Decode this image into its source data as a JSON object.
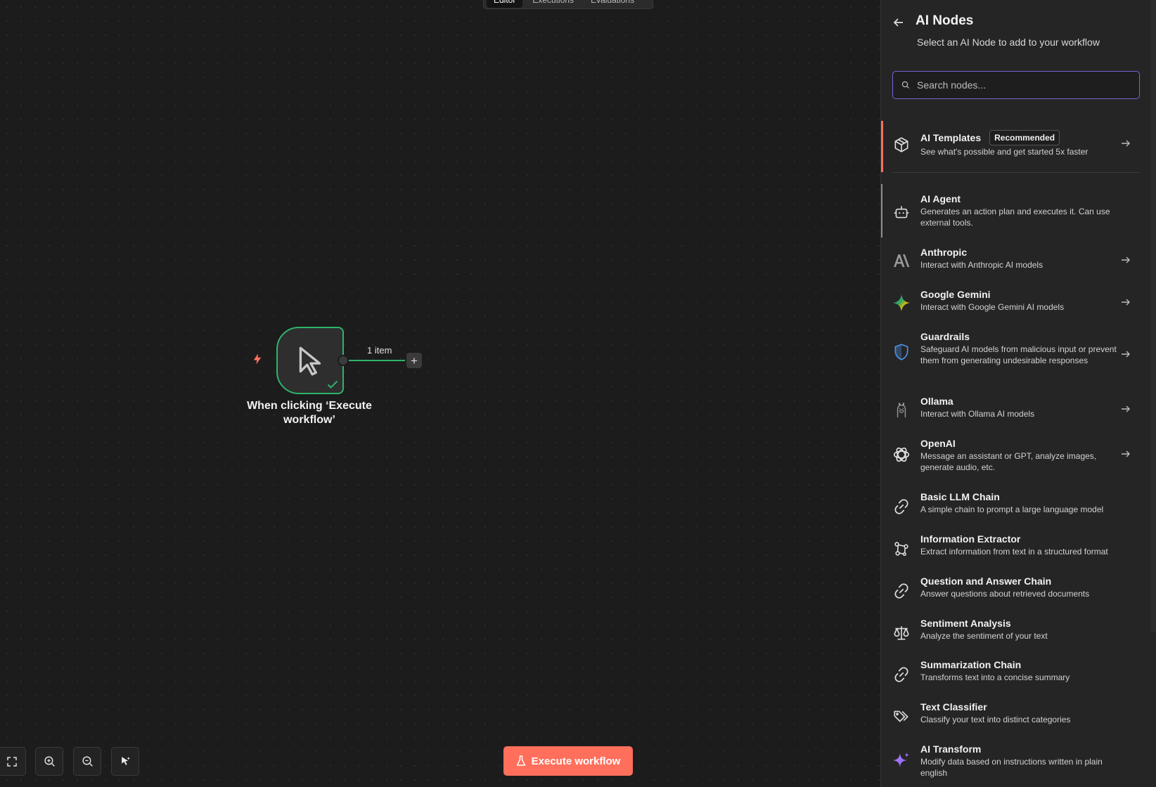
{
  "canvas": {
    "top_tabs": [
      "Editor",
      "Executions",
      "Evaluations"
    ],
    "node": {
      "label": "When clicking ‘Execute workflow’",
      "status": "success"
    },
    "connector_label": "1 item",
    "add_button": "+",
    "execute_button": "Execute workflow"
  },
  "panel": {
    "title": "AI Nodes",
    "subtitle": "Select an AI Node to add to your workflow",
    "search_placeholder": "Search nodes...",
    "templates": {
      "name": "AI Templates",
      "badge": "Recommended",
      "desc": "See what's possible and get started 5x faster"
    },
    "items": [
      {
        "name": "AI Agent",
        "desc": "Generates an action plan and executes it. Can use external tools.",
        "icon": "robot-icon",
        "arrow": false
      },
      {
        "name": "Anthropic",
        "desc": "Interact with Anthropic AI models",
        "icon": "anthropic-icon",
        "arrow": true
      },
      {
        "name": "Google Gemini",
        "desc": "Interact with Google Gemini AI models",
        "icon": "gemini-icon",
        "arrow": true
      },
      {
        "name": "Guardrails",
        "desc": "Safeguard AI models from malicious input or prevent them from generating undesirable responses",
        "icon": "shield-icon",
        "arrow": true
      },
      {
        "name": "Ollama",
        "desc": "Interact with Ollama AI models",
        "icon": "llama-icon",
        "arrow": true
      },
      {
        "name": "OpenAI",
        "desc": "Message an assistant or GPT, analyze images, generate audio, etc.",
        "icon": "openai-icon",
        "arrow": true
      },
      {
        "name": "Basic LLM Chain",
        "desc": "A simple chain to prompt a large language model",
        "icon": "link-icon",
        "arrow": false
      },
      {
        "name": "Information Extractor",
        "desc": "Extract information from text in a structured format",
        "icon": "nodes-icon",
        "arrow": false
      },
      {
        "name": "Question and Answer Chain",
        "desc": "Answer questions about retrieved documents",
        "icon": "link-icon",
        "arrow": false
      },
      {
        "name": "Sentiment Analysis",
        "desc": "Analyze the sentiment of your text",
        "icon": "scale-icon",
        "arrow": false
      },
      {
        "name": "Summarization Chain",
        "desc": "Transforms text into a concise summary",
        "icon": "link-icon",
        "arrow": false
      },
      {
        "name": "Text Classifier",
        "desc": "Classify your text into distinct categories",
        "icon": "tags-icon",
        "arrow": false
      },
      {
        "name": "AI Transform",
        "desc": "Modify data based on instructions written in plain english",
        "icon": "sparkles-icon",
        "arrow": false
      }
    ]
  },
  "colors": {
    "accent": "#ff6f5c",
    "success": "#2fb36a",
    "focus": "#7a63d6"
  }
}
